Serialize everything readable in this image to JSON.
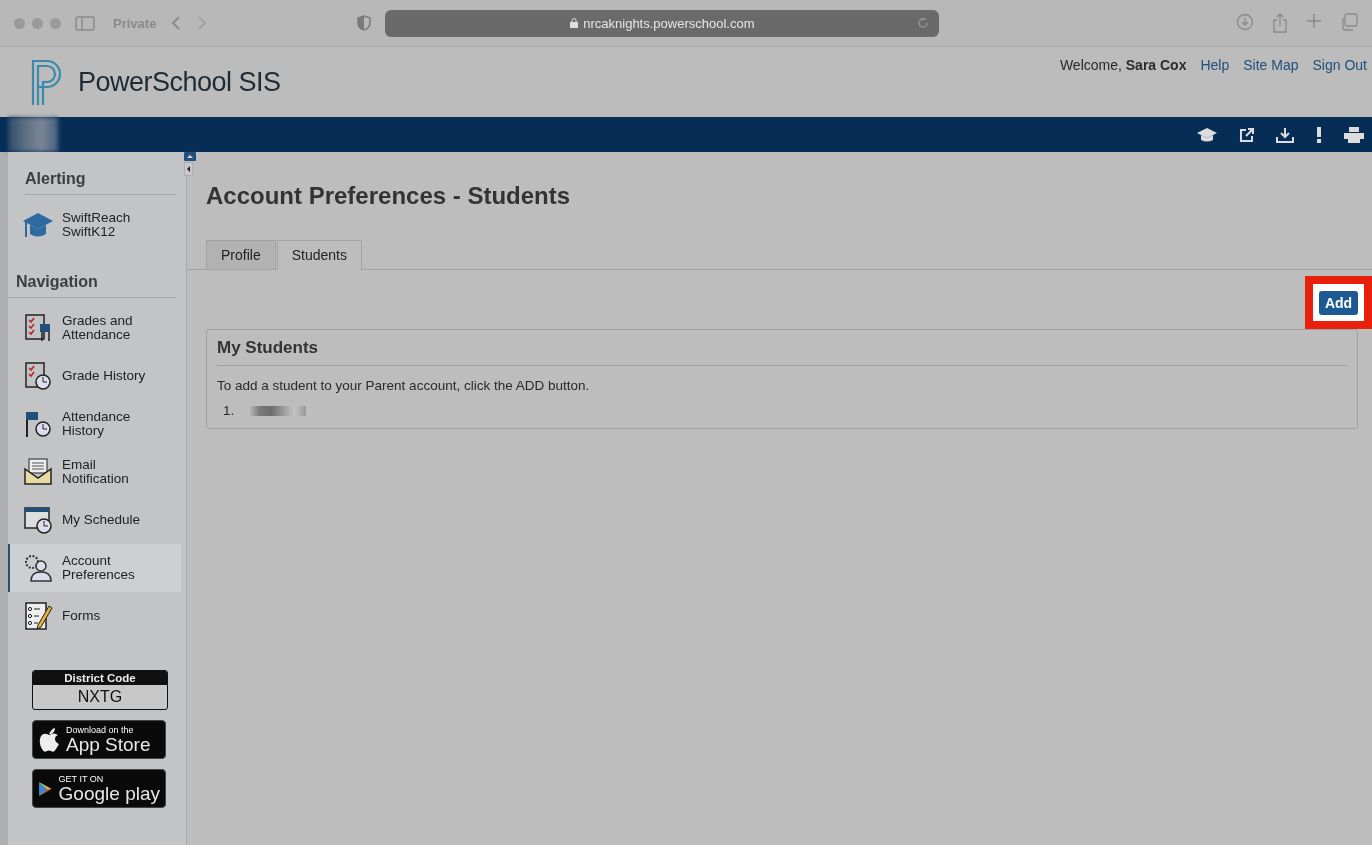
{
  "browser": {
    "private_label": "Private",
    "url": "nrcaknights.powerschool.com"
  },
  "header": {
    "logo_text": "PowerSchool SIS",
    "welcome": "Welcome,",
    "user": "Sara Cox",
    "links": [
      "Help",
      "Site Map",
      "Sign Out"
    ]
  },
  "sidebar": {
    "alerting_title": "Alerting",
    "alerting_items": [
      {
        "label": "SwiftReach\nSwiftK12",
        "kind": "cap"
      }
    ],
    "navigation_title": "Navigation",
    "items": [
      {
        "label": "Grades and\nAttendance",
        "kind": "grades",
        "selected": false
      },
      {
        "label": "Grade History",
        "kind": "history",
        "selected": false
      },
      {
        "label": "Attendance\nHistory",
        "kind": "attendance",
        "selected": false
      },
      {
        "label": "Email\nNotification",
        "kind": "email",
        "selected": false
      },
      {
        "label": "My Schedule",
        "kind": "schedule",
        "selected": false
      },
      {
        "label": "Account\nPreferences",
        "kind": "account",
        "selected": true
      },
      {
        "label": "Forms",
        "kind": "forms",
        "selected": false
      }
    ],
    "district": {
      "title": "District Code",
      "code": "NXTG"
    },
    "badges": [
      {
        "kind": "apple",
        "small": "Download on the",
        "big": "App Store"
      },
      {
        "kind": "google",
        "small": "GET IT ON",
        "big": "Google play"
      }
    ]
  },
  "page": {
    "title": "Account Preferences - Students",
    "tabs": [
      {
        "label": "Profile",
        "selected": false
      },
      {
        "label": "Students",
        "selected": true
      }
    ],
    "add_button": {
      "label": "Add",
      "highlighted": true
    },
    "panel": {
      "title": "My Students",
      "text": "To add a student to your Parent account, click the ADD button.",
      "students": [
        {
          "number": "1."
        }
      ]
    }
  }
}
